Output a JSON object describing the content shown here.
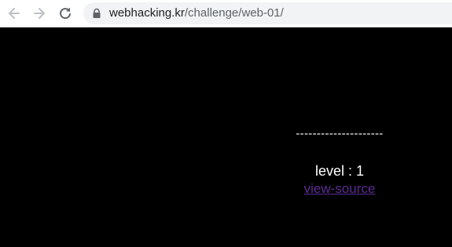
{
  "browser": {
    "url_host": "webhacking.kr",
    "url_path": "/challenge/web-01/",
    "icons": {
      "back": "back-arrow-icon",
      "forward": "forward-arrow-icon",
      "reload": "reload-icon",
      "lock": "lock-icon"
    }
  },
  "page": {
    "separator": "---------------------",
    "level_text": "level : 1",
    "source_link_label": "view-source",
    "colors": {
      "background": "#000000",
      "text": "#ffffff",
      "link": "#5b2c92"
    }
  }
}
